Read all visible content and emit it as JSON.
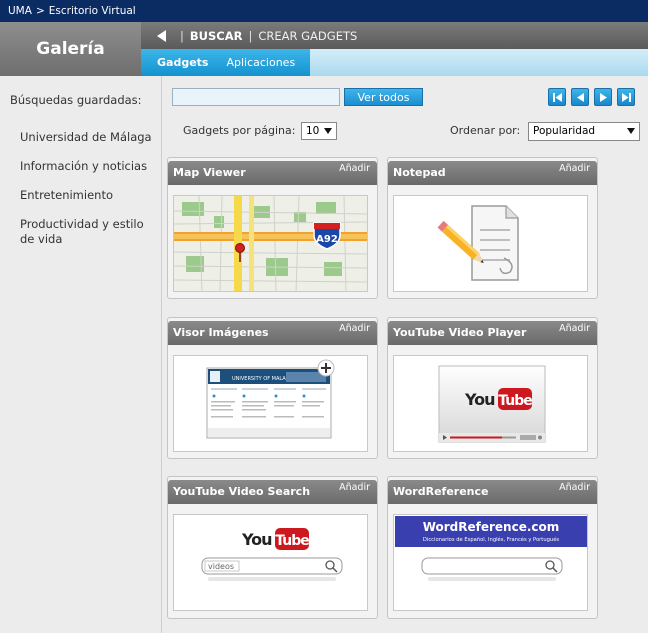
{
  "breadcrumb": {
    "root": "UMA",
    "separator": ">",
    "current": "Escritorio Virtual"
  },
  "header": {
    "title": "Galería",
    "toolbar": {
      "buscar": "BUSCAR",
      "crear": "CREAR GADGETS",
      "separator": "|"
    },
    "tabs": [
      "Gadgets",
      "Aplicaciones"
    ],
    "active_tab": "Gadgets"
  },
  "sidebar": {
    "title": "Búsquedas guardadas:",
    "items": [
      "Universidad de Málaga",
      "Información y noticias",
      "Entretenimiento",
      "Productividad y estilo de vida"
    ]
  },
  "controls": {
    "search_value": "",
    "ver_todos": "Ver todos",
    "per_page_label": "Gadgets por página:",
    "per_page_value": "10",
    "order_label": "Ordenar por:",
    "order_value": "Popularidad",
    "nav_icons": [
      "first-page-icon",
      "prev-page-icon",
      "next-page-icon",
      "last-page-icon"
    ]
  },
  "gadgets": [
    {
      "title": "Map Viewer",
      "add": "Añadir",
      "thumb": "map",
      "badge": "A92"
    },
    {
      "title": "Notepad",
      "add": "Añadir",
      "thumb": "notepad"
    },
    {
      "title": "Visor Imágenes",
      "add": "Añadir",
      "thumb": "visor",
      "caption": "UNIVERSITY OF MALAGA"
    },
    {
      "title": "YouTube Video Player",
      "add": "Añadir",
      "thumb": "ytplayer",
      "logo_you": "You",
      "logo_tube": "Tube"
    },
    {
      "title": "YouTube Video Search",
      "add": "Añadir",
      "thumb": "ytsearch",
      "logo_you": "You",
      "logo_tube": "Tube",
      "search_value": "videos"
    },
    {
      "title": "WordReference",
      "add": "Añadir",
      "thumb": "wordref",
      "brand": "WordReference.com",
      "tagline": "Diccionarios de Español, Inglés, Francés y Portugués"
    }
  ],
  "colors": {
    "topbar": "#0b2b63",
    "accent": "#1a8ed0",
    "tab_bar": "#aad9ef",
    "youtube_red": "#cc181e"
  }
}
